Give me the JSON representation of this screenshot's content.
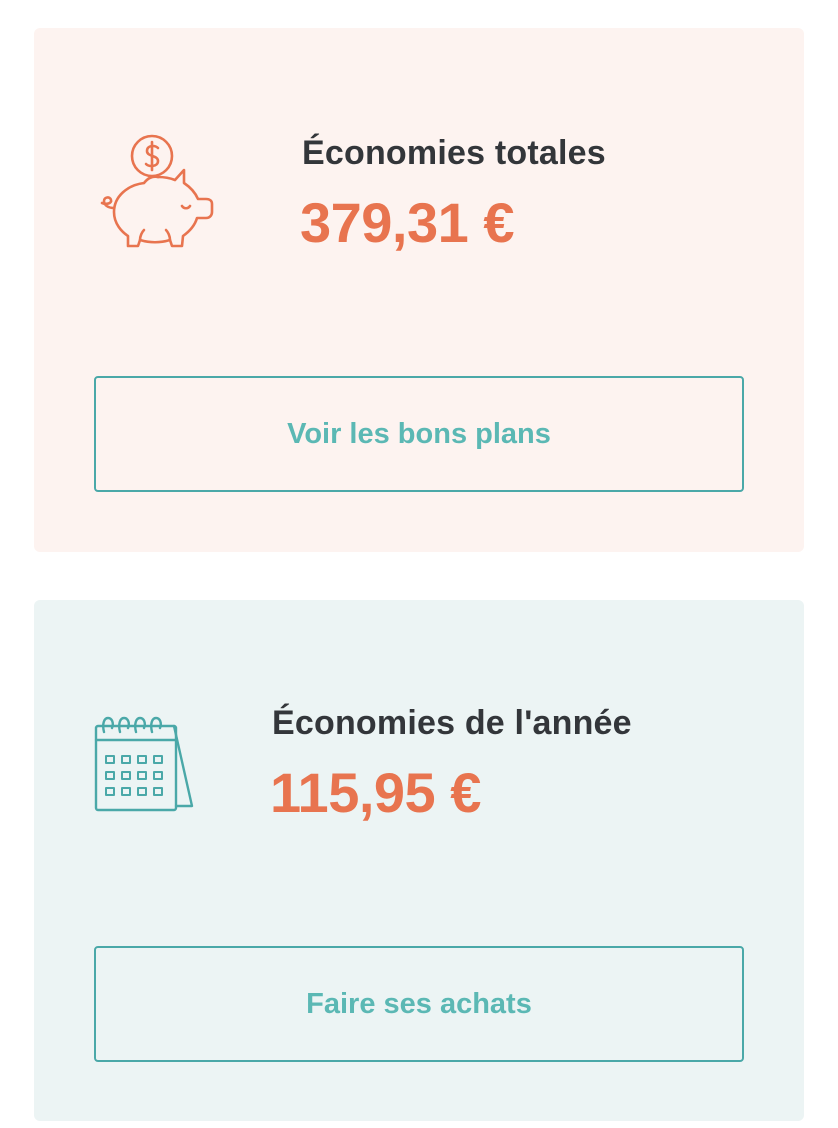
{
  "cards": [
    {
      "title": "Économies totales",
      "amount": "379,31 €",
      "button_label": "Voir les bons plans",
      "icon": "piggy-bank-icon"
    },
    {
      "title": "Économies de l'année",
      "amount": "115,95 €",
      "button_label": "Faire ses achats",
      "icon": "calendar-icon"
    }
  ],
  "colors": {
    "accent_orange": "#e8744f",
    "accent_teal": "#4aa8a8",
    "card_total_bg": "#fdf3f0",
    "card_year_bg": "#ecf4f4",
    "title_text": "#33363a"
  }
}
